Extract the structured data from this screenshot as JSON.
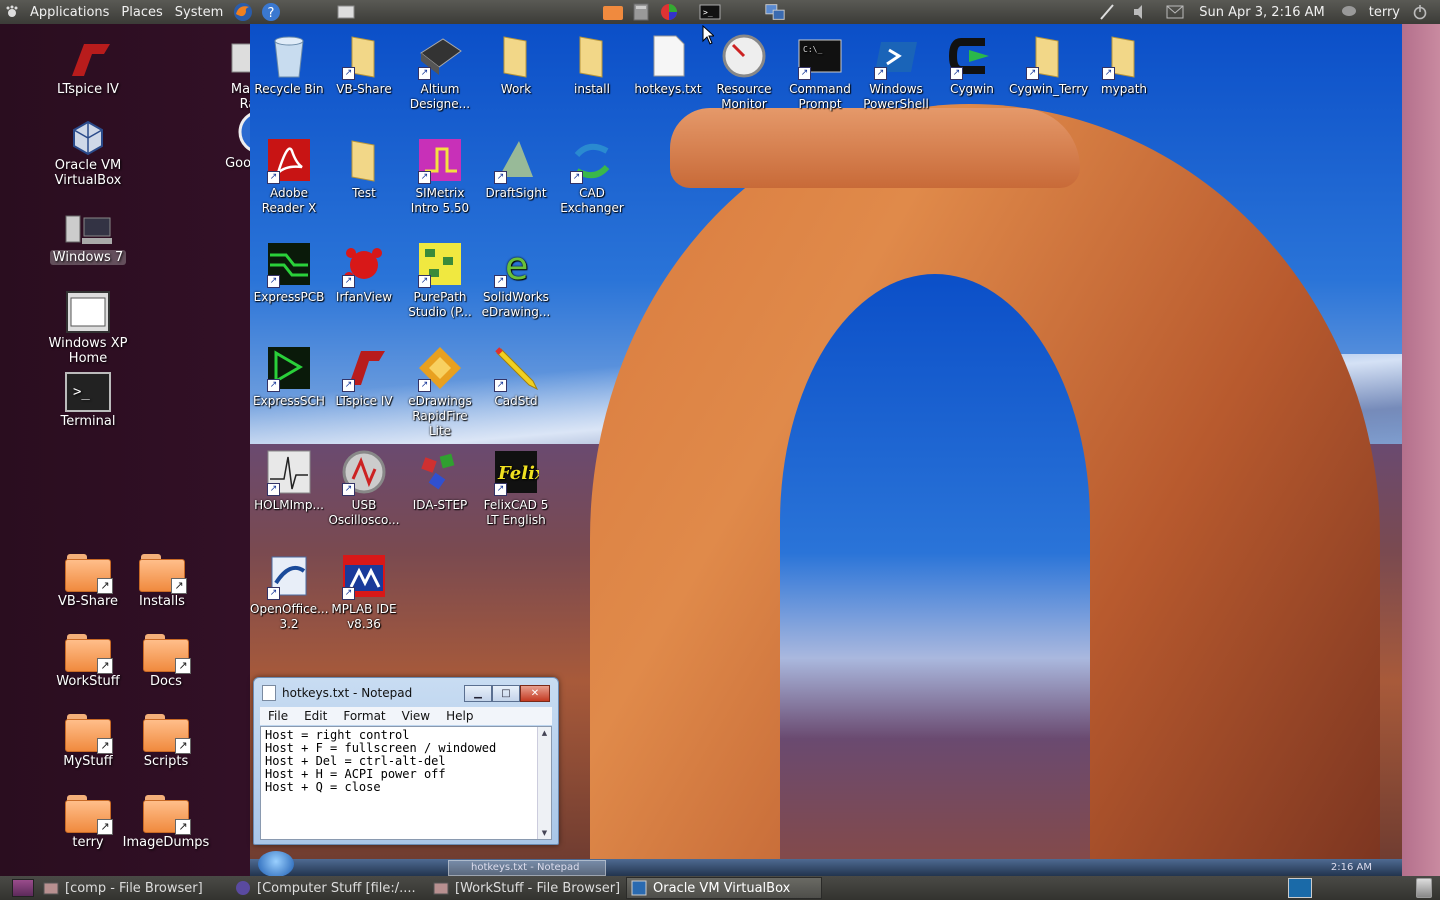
{
  "top_panel": {
    "menus": [
      "Applications",
      "Places",
      "System"
    ],
    "clock": "Sun Apr  3,  2:16 AM",
    "user": "terry"
  },
  "host_desktop": {
    "icons": [
      {
        "label": "LTspice IV"
      },
      {
        "label": "Make Ra"
      },
      {
        "label": "Oracle VM VirtualBox"
      },
      {
        "label": "Google"
      },
      {
        "label": "Windows 7"
      },
      {
        "label": "Windows XP Home"
      },
      {
        "label": "Terminal"
      }
    ],
    "folders": [
      {
        "label": "VB-Share"
      },
      {
        "label": "Installs"
      },
      {
        "label": "WorkStuff"
      },
      {
        "label": "Docs"
      },
      {
        "label": "MyStuff"
      },
      {
        "label": "Scripts"
      },
      {
        "label": "terry"
      },
      {
        "label": "ImageDumps"
      }
    ]
  },
  "guest_desktop": {
    "icons": [
      {
        "label": "Recycle Bin"
      },
      {
        "label": "VB-Share"
      },
      {
        "label": "Altium Designe..."
      },
      {
        "label": "Work"
      },
      {
        "label": "install"
      },
      {
        "label": "hotkeys.txt"
      },
      {
        "label": "Resource Monitor"
      },
      {
        "label": "Command Prompt"
      },
      {
        "label": "Windows PowerShell"
      },
      {
        "label": "Cygwin"
      },
      {
        "label": "Cygwin_Terry"
      },
      {
        "label": "mypath"
      },
      {
        "label": "Adobe Reader X"
      },
      {
        "label": "Test"
      },
      {
        "label": "SIMetrix Intro 5.50"
      },
      {
        "label": "DraftSight"
      },
      {
        "label": "CAD Exchanger"
      },
      {
        "label": "ExpressPCB"
      },
      {
        "label": "IrfanView"
      },
      {
        "label": "PurePath Studio (P..."
      },
      {
        "label": "SolidWorks eDrawing..."
      },
      {
        "label": "ExpressSCH"
      },
      {
        "label": "LTspice IV"
      },
      {
        "label": "eDrawings RapidFire Lite"
      },
      {
        "label": "CadStd"
      },
      {
        "label": "HOLMImp..."
      },
      {
        "label": "USB Oscillosco..."
      },
      {
        "label": "IDA-STEP"
      },
      {
        "label": "FelixCAD 5 LT English"
      },
      {
        "label": "OpenOffice... 3.2"
      },
      {
        "label": "MPLAB IDE v8.36"
      }
    ],
    "taskbar_item": "hotkeys.txt - Notepad",
    "taskbar_clock": "2:16 AM"
  },
  "notepad": {
    "title": "hotkeys.txt - Notepad",
    "menu": [
      "File",
      "Edit",
      "Format",
      "View",
      "Help"
    ],
    "content": "Host = right control\nHost + F = fullscreen / windowed\nHost + Del = ctrl-alt-del\nHost + H = ACPI power off\nHost + Q = close"
  },
  "bottom_panel": {
    "tasks": [
      {
        "label": "[comp - File Browser]"
      },
      {
        "label": "[Computer Stuff [file:/...."
      },
      {
        "label": "[WorkStuff - File Browser]"
      },
      {
        "label": "Oracle VM VirtualBox"
      }
    ]
  },
  "colors": {
    "panel": "#3b3b37",
    "host_bg": "#3d1430",
    "sky": "#0b4fc8",
    "rock": "#d97a3e",
    "folder": "#f08a3e"
  }
}
